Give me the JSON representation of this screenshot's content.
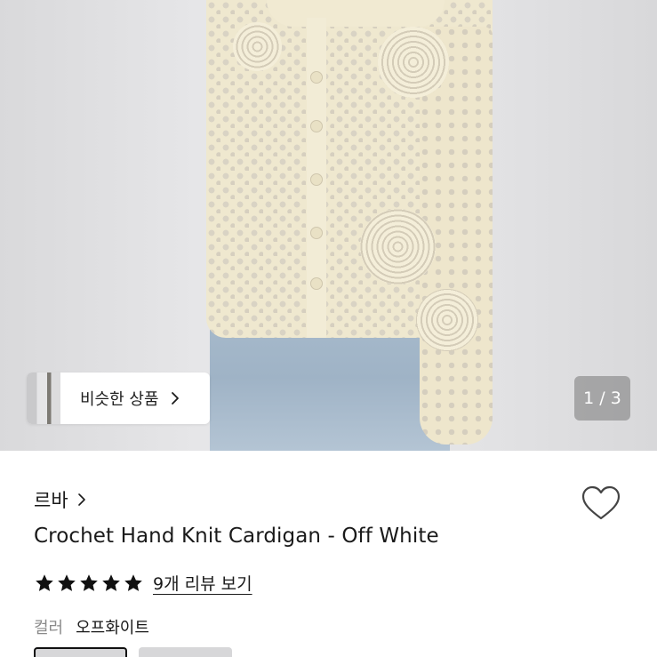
{
  "gallery": {
    "counter": "1 / 3",
    "similar_products_label": "비슷한 상품"
  },
  "product": {
    "brand": "르바",
    "title": "Crochet Hand Knit Cardigan - Off White",
    "rating_stars": 5,
    "review_link": "9개 리뷰 보기",
    "option_label": "컬러",
    "option_value": "오프화이트"
  },
  "icons": {
    "heart": "heart-outline-icon",
    "chevron": "chevron-right-icon",
    "star": "star-filled-icon"
  },
  "colors": {
    "text": "#1a1a1a",
    "muted": "#8a8a8a",
    "counter_bg": "#8a8a8a"
  }
}
